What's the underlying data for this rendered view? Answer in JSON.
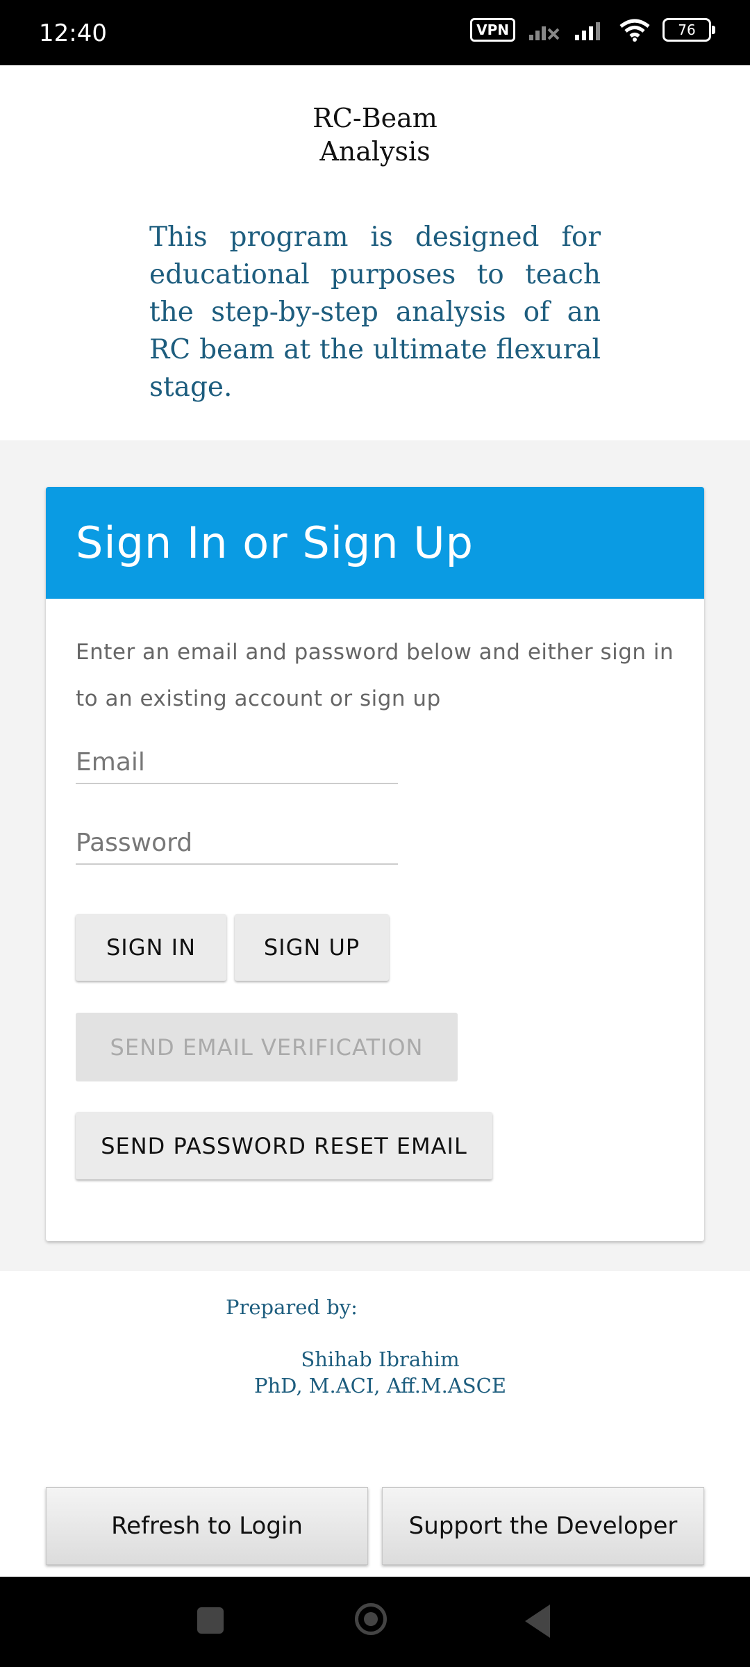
{
  "status_bar": {
    "time": "12:40",
    "vpn": "VPN",
    "battery": "76",
    "icons": [
      "vpn-icon",
      "signal-off-icon",
      "signal-icon",
      "wifi-icon",
      "battery-icon"
    ]
  },
  "header": {
    "title_line1": "RC-Beam",
    "title_line2": "Analysis",
    "intro": "This program is designed for educational purposes to teach the step-by-step analysis of an RC beam at the ultimate flexural stage."
  },
  "auth_card": {
    "title": "Sign In or Sign Up",
    "description": "Enter an email and password below and either sign in to an existing account or sign up",
    "email_placeholder": "Email",
    "password_placeholder": "Password",
    "sign_in": "SIGN IN",
    "sign_up": "SIGN UP",
    "send_verification": "SEND EMAIL VERIFICATION",
    "send_reset": "SEND PASSWORD RESET EMAIL",
    "header_color": "#0a9be3"
  },
  "credits": {
    "prepared_by": "Prepared by:",
    "name": "Shihab Ibrahim",
    "degrees": "PhD, M.ACI, Aff.M.ASCE"
  },
  "footer": {
    "refresh": "Refresh to Login",
    "support": "Support the Developer"
  },
  "nav": [
    "recents-icon",
    "home-icon",
    "back-icon"
  ]
}
